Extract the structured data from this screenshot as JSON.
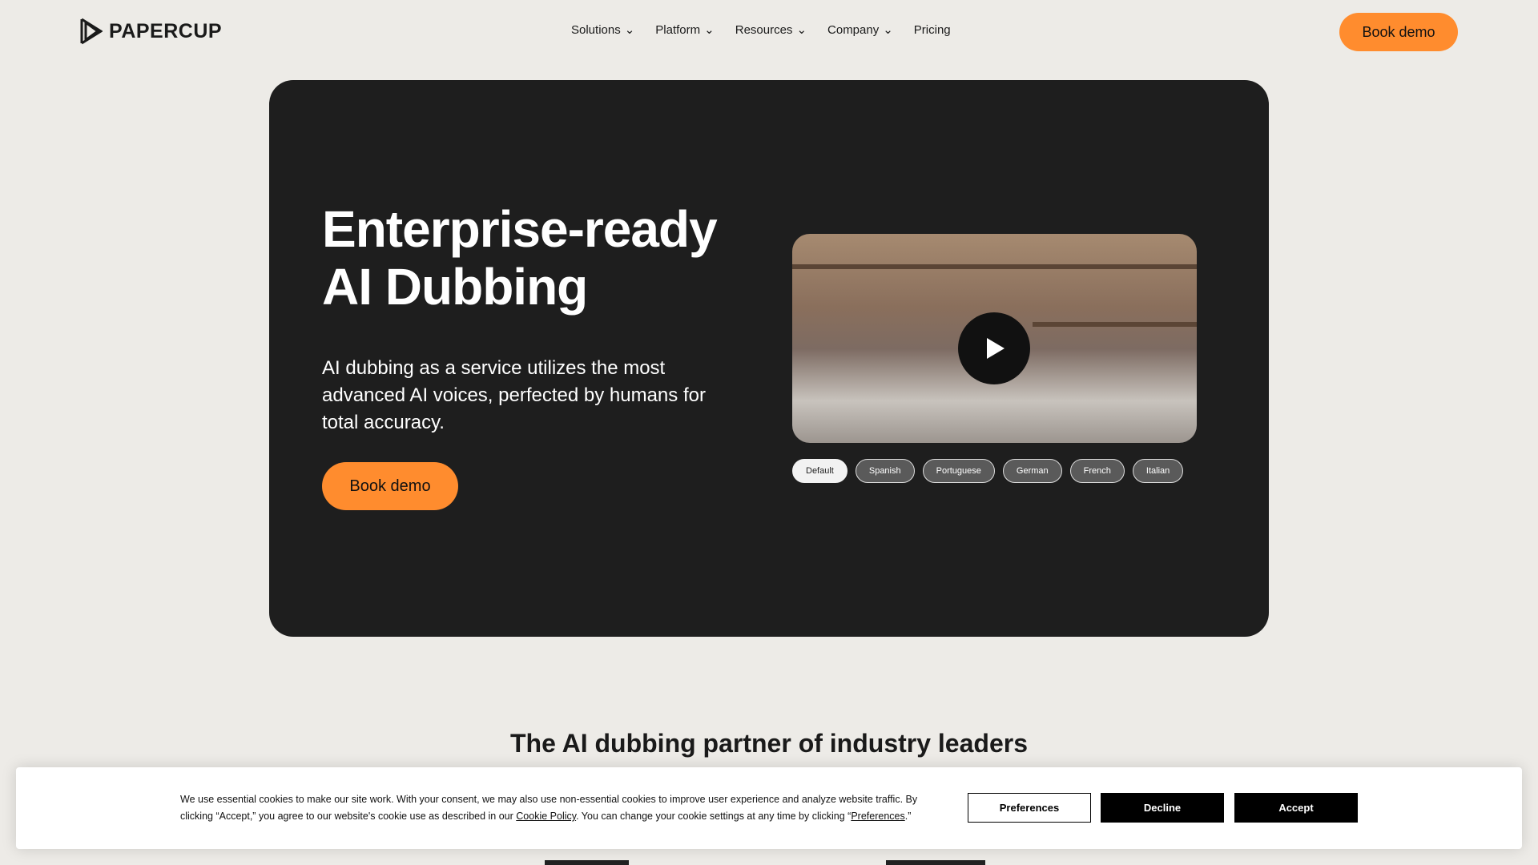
{
  "header": {
    "logo": "PAPERCUP",
    "nav": [
      {
        "label": "Solutions",
        "dropdown": true
      },
      {
        "label": "Platform",
        "dropdown": true
      },
      {
        "label": "Resources",
        "dropdown": true
      },
      {
        "label": "Company",
        "dropdown": true
      },
      {
        "label": "Pricing",
        "dropdown": false
      }
    ],
    "cta": "Book demo"
  },
  "hero": {
    "title_line1": "Enterprise-ready",
    "title_line2": "AI Dubbing",
    "description": "AI dubbing as a service utilizes the most advanced AI voices, perfected by humans for total accuracy.",
    "cta": "Book demo",
    "video": {
      "icon": "play-icon"
    },
    "languages": [
      {
        "label": "Default",
        "active": true
      },
      {
        "label": "Spanish"
      },
      {
        "label": "Portuguese"
      },
      {
        "label": "German"
      },
      {
        "label": "French"
      },
      {
        "label": "Italian"
      }
    ]
  },
  "partners": {
    "heading": "The AI dubbing partner of industry leaders"
  },
  "cookie": {
    "text_before": "We use essential cookies to make our site work. With your consent, we may also use non-essential cookies to improve user experience and analyze website traffic. By clicking “Accept,” you agree to our website's cookie use as described in our ",
    "policy_link": "Cookie Policy",
    "text_middle": ". You can change your cookie settings at any time by clicking “",
    "pref_link": "Preferences",
    "text_after": ".”",
    "preferences": "Preferences",
    "decline": "Decline",
    "accept": "Accept"
  },
  "colors": {
    "accent": "#ff8c2e",
    "hero_bg": "#1e1e1e",
    "page_bg": "#edebe7"
  }
}
